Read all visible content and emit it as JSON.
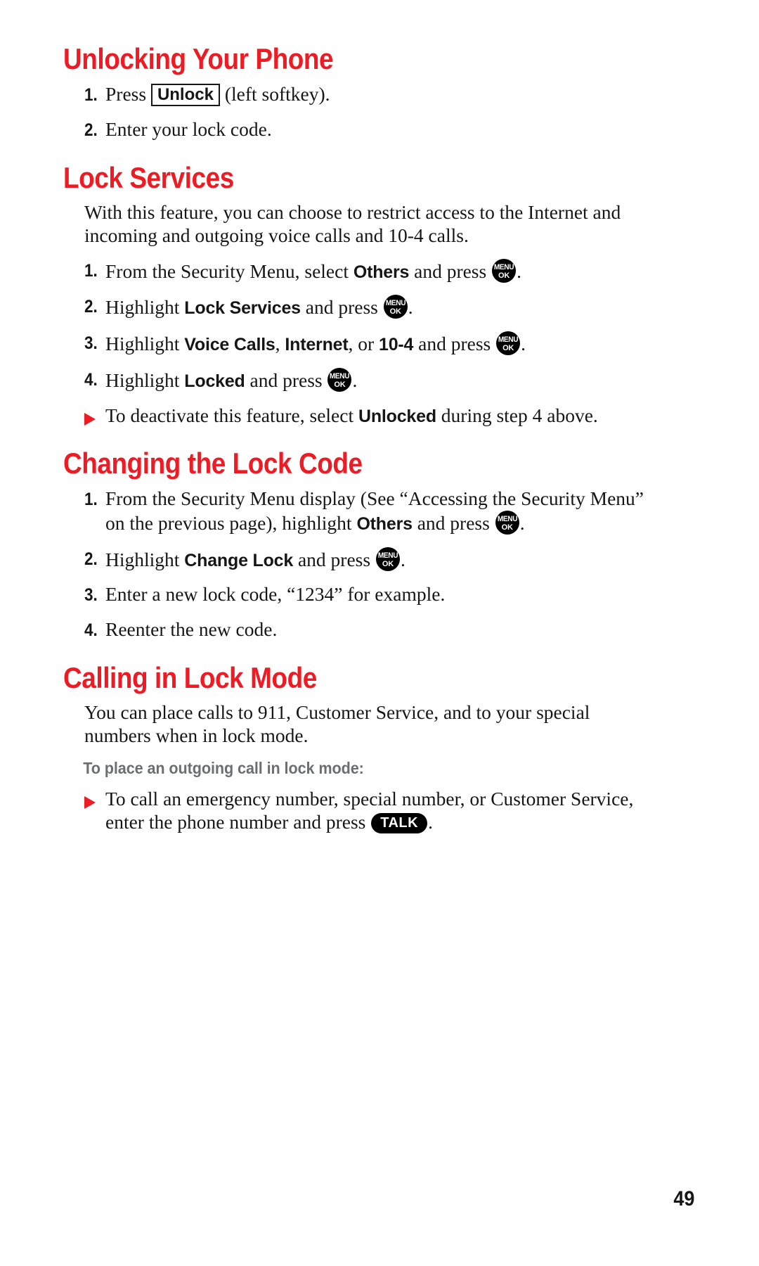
{
  "page": {
    "number": "49",
    "accent_color": "#ed1c24",
    "text_color": "#161616",
    "subheading_color": "#6d6e71"
  },
  "icons": {
    "menu_ok": {
      "top": "MENU",
      "bottom": "OK"
    },
    "talk": "TALK",
    "triangle_bullet": "triangle-bullet"
  },
  "sections": [
    {
      "heading": "Unlocking Your Phone",
      "steps": [
        {
          "num": "1.",
          "pre": "Press",
          "boxed": "Unlock",
          "post": "(left softkey)."
        },
        {
          "num": "2.",
          "text": "Enter your lock code."
        }
      ]
    },
    {
      "heading": "Lock Services",
      "intro": "With this feature, you can choose to restrict access to the Internet and incoming and outgoing voice calls and 10-4 calls.",
      "steps": [
        {
          "num": "1.",
          "pre": "From the Security Menu, select",
          "ui1": "Others",
          "mid": "and press",
          "post": "."
        },
        {
          "num": "2.",
          "pre": "Highlight",
          "ui1": "Lock Services",
          "mid": "and press",
          "post": "."
        },
        {
          "num": "3.",
          "pre": "Highlight",
          "ui1": "Voice Calls",
          "sep1": ",",
          "ui2": "Internet",
          "sep2": ", or",
          "ui3": "10-4",
          "mid": "and press",
          "post": "."
        },
        {
          "num": "4.",
          "pre": "Highlight",
          "ui1": "Locked",
          "mid": "and press",
          "post": "."
        }
      ],
      "bullets": [
        {
          "pre": "To deactivate this feature, select",
          "ui1": "Unlocked",
          "post": "during step 4 above."
        }
      ]
    },
    {
      "heading": "Changing the Lock Code",
      "steps": [
        {
          "num": "1.",
          "pre": "From the Security Menu display (See “Accessing the Security Menu” on the previous page), highlight",
          "ui1": "Others",
          "mid": "and press",
          "post": "."
        },
        {
          "num": "2.",
          "pre": "Highlight",
          "ui1": "Change Lock",
          "mid": "and press",
          "post": "."
        },
        {
          "num": "3.",
          "text": "Enter a new lock code, “1234” for example."
        },
        {
          "num": "4.",
          "text": "Reenter the new code."
        }
      ]
    },
    {
      "heading": "Calling in Lock Mode",
      "intro": "You can place calls to 911, Customer Service, and to your special numbers when in lock mode.",
      "subheading": "To place an outgoing call in lock mode:",
      "bullets": [
        {
          "pre": "To call an emergency number, special number, or Customer Service, enter the phone number and press",
          "post": "."
        }
      ]
    }
  ]
}
